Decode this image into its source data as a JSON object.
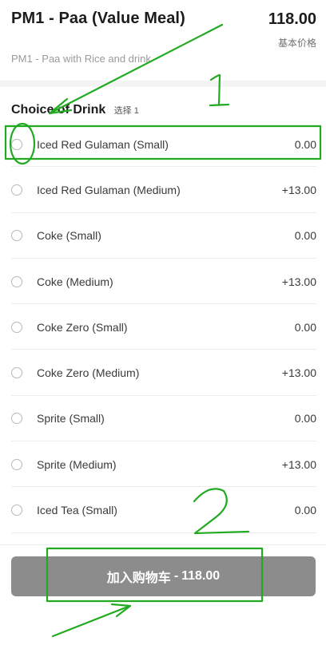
{
  "item": {
    "title": "PM1 - Paa (Value Meal)",
    "price": "118.00",
    "base_price_label": "基本价格",
    "description": "PM1 - Paa with Rice and drink"
  },
  "section": {
    "title": "Choice of Drink",
    "hint": "选择 1"
  },
  "options": [
    {
      "label": "Iced Red Gulaman (Small)",
      "price": "0.00"
    },
    {
      "label": "Iced Red Gulaman (Medium)",
      "price": "+13.00"
    },
    {
      "label": "Coke (Small)",
      "price": "0.00"
    },
    {
      "label": "Coke (Medium)",
      "price": "+13.00"
    },
    {
      "label": "Coke Zero (Small)",
      "price": "0.00"
    },
    {
      "label": "Coke Zero (Medium)",
      "price": "+13.00"
    },
    {
      "label": "Sprite (Small)",
      "price": "0.00"
    },
    {
      "label": "Sprite (Medium)",
      "price": "+13.00"
    },
    {
      "label": "Iced Tea (Small)",
      "price": "0.00"
    }
  ],
  "cart_button": {
    "label": "加入购物车",
    "separator": "-",
    "total": "118.00"
  },
  "annotations": {
    "marker_1": "1",
    "marker_2": "2",
    "color": "#22aa22"
  },
  "colors": {
    "button_bg": "#8c8c8c",
    "annotation": "#22aa22"
  }
}
